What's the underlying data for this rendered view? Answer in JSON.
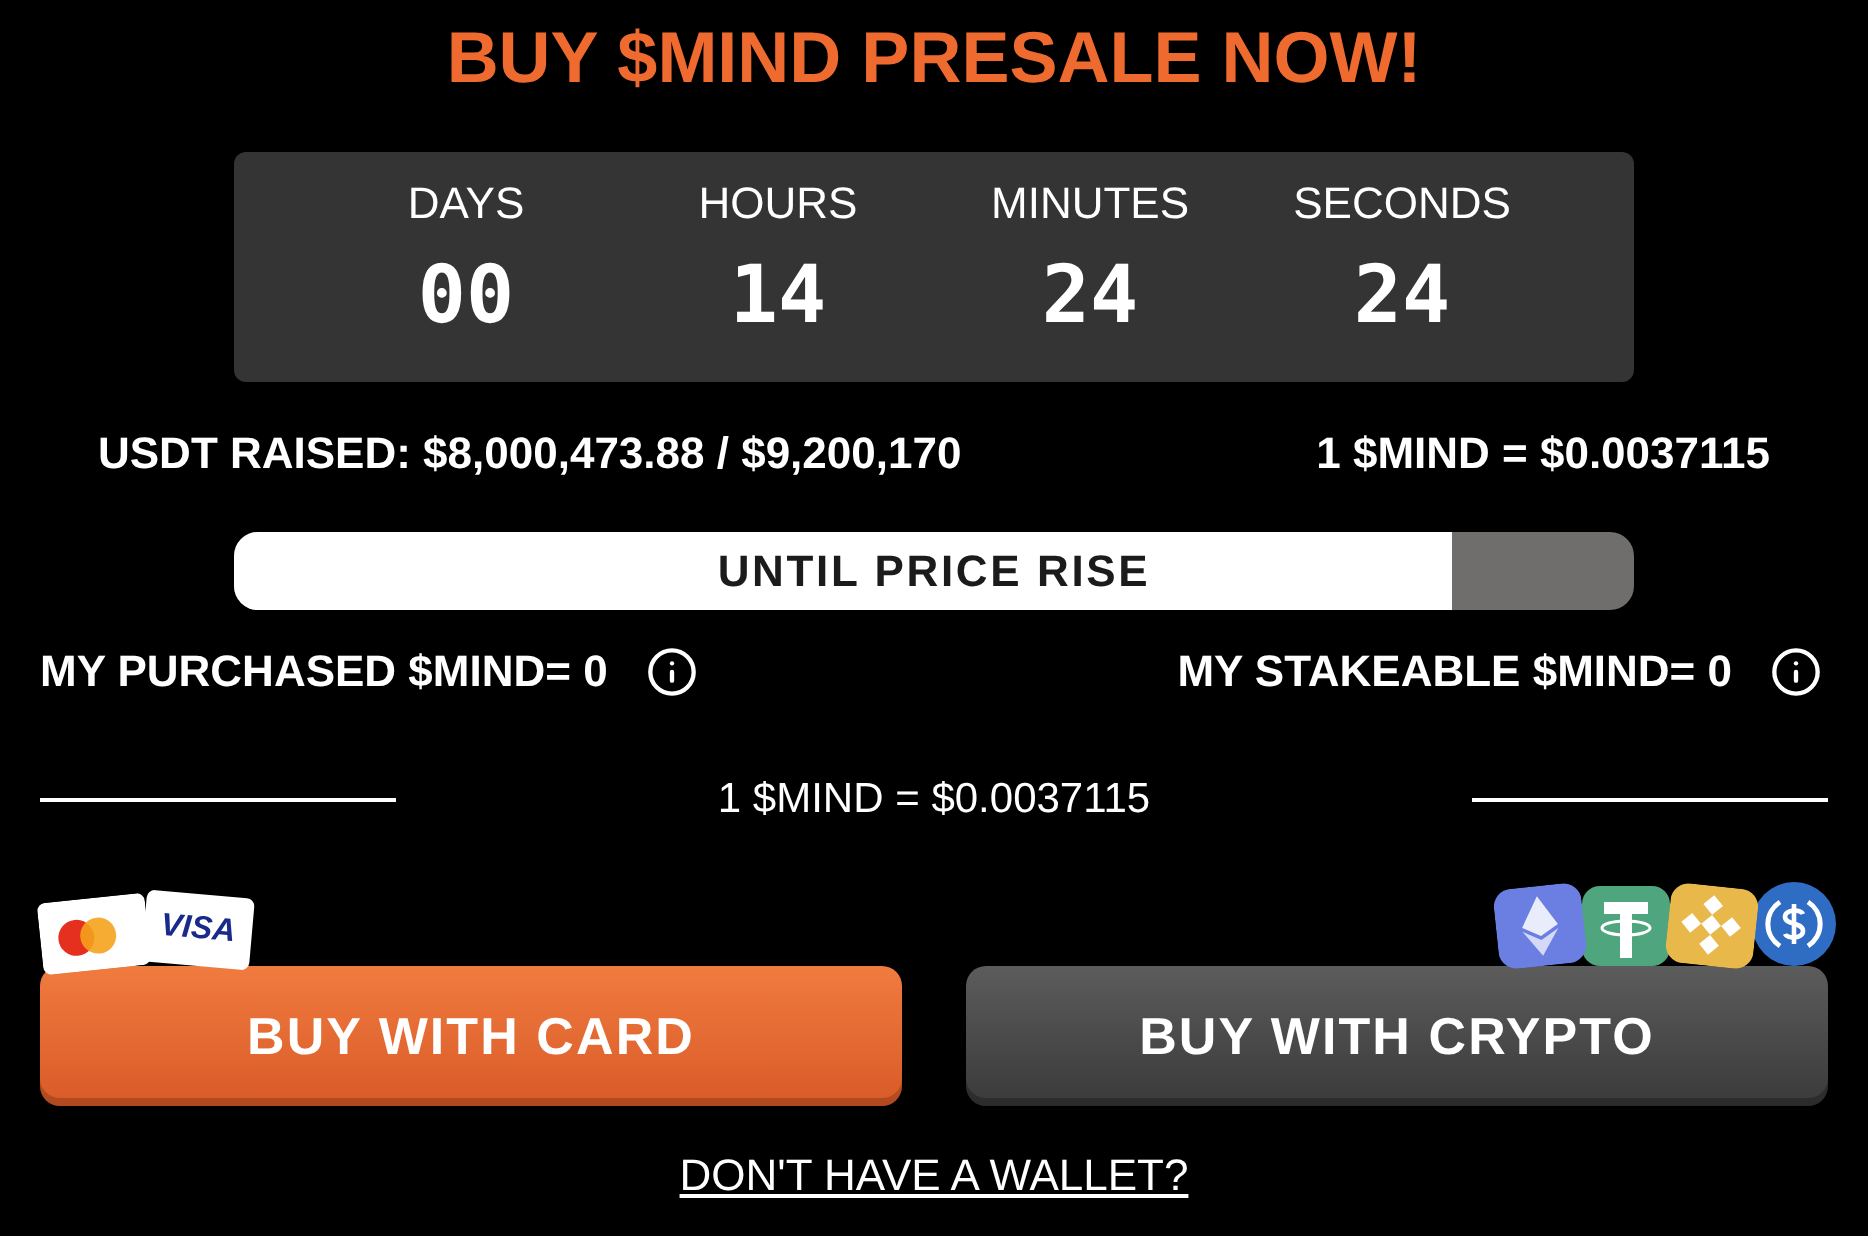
{
  "headline": "BUY $MIND PRESALE NOW!",
  "countdown": [
    {
      "label": "DAYS",
      "value": "00"
    },
    {
      "label": "HOURS",
      "value": "14"
    },
    {
      "label": "MINUTES",
      "value": "24"
    },
    {
      "label": "SECONDS",
      "value": "24"
    }
  ],
  "raised": "USDT RAISED: $8,000,473.88 / $9,200,170",
  "price": "1 $MIND = $0.0037115",
  "progress": {
    "label": "UNTIL PRICE RISE",
    "level": 0.87
  },
  "balances": [
    {
      "label": "MY PURCHASED $MIND= 0"
    },
    {
      "label": "MY STAKEABLE $MIND= 0"
    }
  ],
  "divider_price": "1 $MIND = $0.0037115",
  "buttons": [
    {
      "label": "BUY WITH CARD",
      "kind": "card",
      "logo_text": "VISA"
    },
    {
      "label": "BUY WITH CRYPTO",
      "kind": "crypto"
    }
  ],
  "wallet_link": "DON'T HAVE A WALLET?"
}
